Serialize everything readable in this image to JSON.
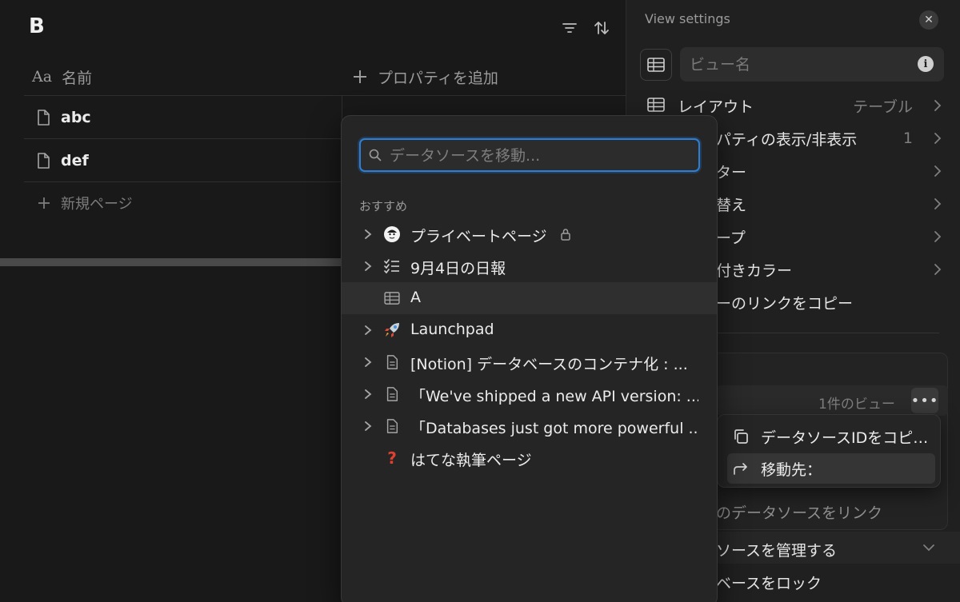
{
  "database": {
    "title": "B",
    "name_column": "名前",
    "add_property": "プロパティを追加",
    "rows": [
      "abc",
      "def"
    ],
    "new_page": "新規ページ"
  },
  "panel": {
    "title": "View settings",
    "view_name_placeholder": "ビュー名",
    "settings": [
      {
        "label": "レイアウト",
        "value": "テーブル"
      },
      {
        "label": "パティの表示/非表示",
        "value": "1"
      },
      {
        "label": "ター",
        "value": ""
      },
      {
        "label": "替え",
        "value": ""
      },
      {
        "label": "ープ",
        "value": ""
      },
      {
        "label": "付きカラー",
        "value": ""
      },
      {
        "label": "ーのリンクをコピー",
        "value": ""
      }
    ],
    "views_count": "1件のビュー",
    "link_data_source": "のデータソースをリンク",
    "manage_data_sources": "ソースを管理する",
    "lock_database": "ベースをロック"
  },
  "context_menu": {
    "items": [
      {
        "label": "データソースIDをコピ…",
        "icon": "copy-icon"
      },
      {
        "label": "移動先：",
        "icon": "move-arrow-icon"
      }
    ]
  },
  "move_popup": {
    "search_placeholder": "データソースを移動...",
    "section": "おすすめ",
    "items": [
      {
        "label": "プライベートページ",
        "icon": "avatar-icon",
        "has_chevron": true,
        "locked": true
      },
      {
        "label": "9月4日の日報",
        "icon": "checklist-icon",
        "has_chevron": true,
        "locked": false
      },
      {
        "label": "A",
        "icon": "table-icon",
        "has_chevron": false,
        "locked": false
      },
      {
        "label": "Launchpad",
        "icon": "rocket-icon",
        "has_chevron": true,
        "locked": false
      },
      {
        "label": "[Notion] データベースのコンテナ化 : ...",
        "icon": "page-icon",
        "has_chevron": true,
        "locked": false
      },
      {
        "label": "「We've shipped a new API version: ...",
        "icon": "page-icon",
        "has_chevron": true,
        "locked": false
      },
      {
        "label": "「Databases just got more powerful ...",
        "icon": "page-icon",
        "has_chevron": true,
        "locked": false
      },
      {
        "label": "はてな執筆ページ",
        "icon": "question-icon",
        "has_chevron": false,
        "locked": false
      }
    ]
  },
  "colors": {
    "background": "#191919",
    "panel": "#202020",
    "popup": "#252525",
    "accent_focus": "#2d7fd6"
  }
}
